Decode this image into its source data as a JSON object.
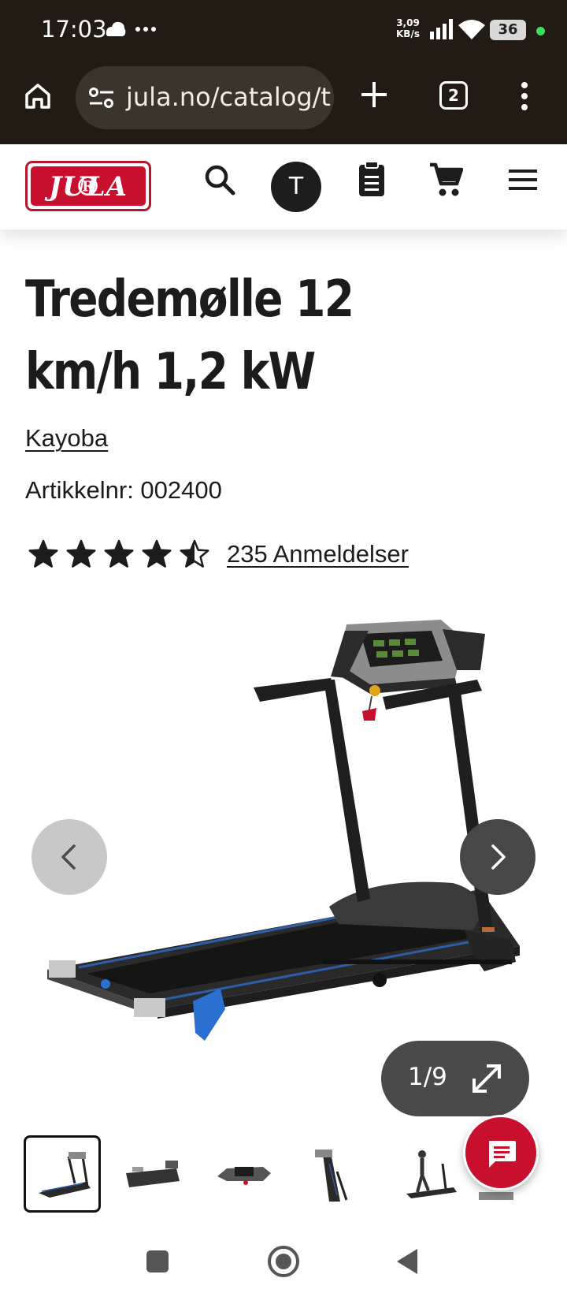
{
  "status_bar": {
    "time": "17:03",
    "network_speed": "3,09",
    "network_unit": "KB/s",
    "battery": "36",
    "battery_dot_color": "#3ddc5b"
  },
  "browser": {
    "url": "jula.no/catalog/t",
    "tab_count": "2",
    "icons": [
      "home-icon",
      "site-settings-icon",
      "new-tab-icon",
      "tab-switcher-icon",
      "more-vert-icon"
    ]
  },
  "site_header": {
    "logo_text": "JULA",
    "logo_mark": "®",
    "avatar_initial": "T",
    "brand_color": "#c8102e",
    "icons": [
      "search-icon",
      "shopping-list-icon",
      "cart-icon",
      "menu-icon"
    ]
  },
  "product": {
    "title": "Tredemølle 12 km/h 1,2 kW",
    "brand": "Kayoba",
    "article_number": "Artikkelnr: 002400",
    "rating": 4.5,
    "rating_max": 5,
    "reviews": "235 Anmeldelser"
  },
  "gallery": {
    "counter": "1/9",
    "current": 1,
    "total": 9,
    "thumbnail_count": 6
  },
  "system_nav": {
    "icons": [
      "recents-icon",
      "home-circle-icon",
      "back-triangle-icon"
    ]
  }
}
